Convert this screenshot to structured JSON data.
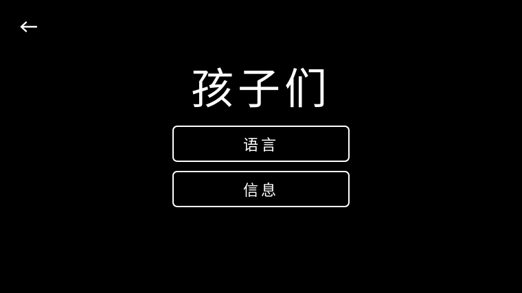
{
  "header": {
    "back_icon": "arrow-left-icon"
  },
  "title": "孩子们",
  "menu": {
    "items": [
      {
        "label": "语言"
      },
      {
        "label": "信息"
      }
    ]
  },
  "colors": {
    "background": "#000000",
    "foreground": "#ffffff"
  }
}
